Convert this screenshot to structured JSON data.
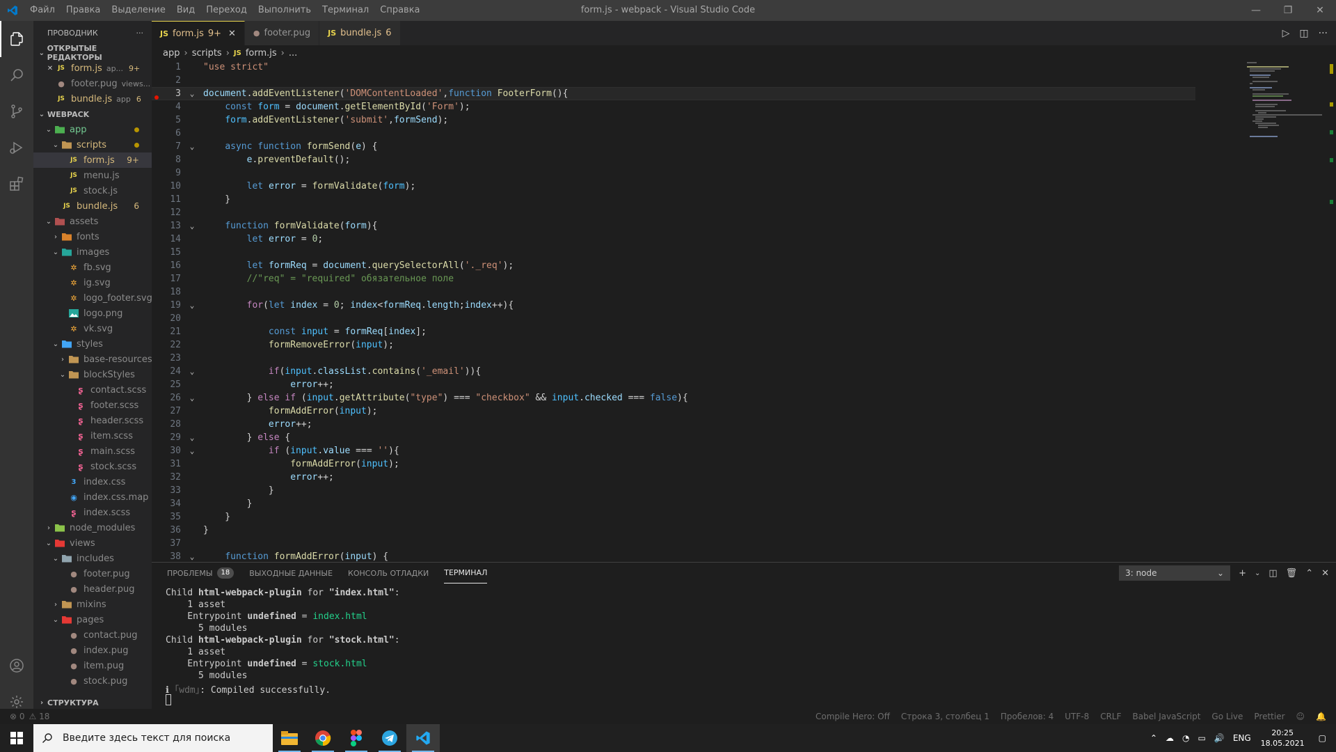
{
  "window": {
    "title": "form.js - webpack - Visual Studio Code",
    "menu": [
      "Файл",
      "Правка",
      "Выделение",
      "Вид",
      "Переход",
      "Выполнить",
      "Терминал",
      "Справка"
    ]
  },
  "sidebar": {
    "title": "ПРОВОДНИК",
    "more": "···",
    "open_editors_label": "ОТКРЫТЫЕ РЕДАКТОРЫ",
    "open_editors": [
      {
        "name": "form.js",
        "desc": "ap...",
        "badge": "9+",
        "icon": "JS",
        "close": "✕"
      },
      {
        "name": "footer.pug",
        "desc": "views...",
        "badge": "",
        "icon": "pug"
      },
      {
        "name": "bundle.js",
        "desc": "app",
        "badge": "6",
        "icon": "JS"
      }
    ],
    "workspace_label": "WEBPACK",
    "outline_label": "СТРУКТУРА",
    "tree": [
      {
        "label": "app",
        "depth": 1,
        "type": "folder-app",
        "open": true,
        "dot": true,
        "color": "green"
      },
      {
        "label": "scripts",
        "depth": 2,
        "type": "folder",
        "open": true,
        "dot": true,
        "color": "yellow"
      },
      {
        "label": "form.js",
        "depth": 3,
        "type": "js",
        "badge": "9+",
        "color": "yellow",
        "selected": true
      },
      {
        "label": "menu.js",
        "depth": 3,
        "type": "js",
        "color": "dim"
      },
      {
        "label": "stock.js",
        "depth": 3,
        "type": "js",
        "color": "dim"
      },
      {
        "label": "bundle.js",
        "depth": 2,
        "type": "js",
        "badge": "6",
        "color": "yellow"
      },
      {
        "label": "assets",
        "depth": 1,
        "type": "folder-assets",
        "open": true,
        "color": "dim"
      },
      {
        "label": "fonts",
        "depth": 2,
        "type": "folder-fonts",
        "open": false,
        "color": "dim"
      },
      {
        "label": "images",
        "depth": 2,
        "type": "folder-images",
        "open": true,
        "color": "dim"
      },
      {
        "label": "fb.svg",
        "depth": 3,
        "type": "svg",
        "color": "dim"
      },
      {
        "label": "ig.svg",
        "depth": 3,
        "type": "svg",
        "color": "dim"
      },
      {
        "label": "logo_footer.svg",
        "depth": 3,
        "type": "svg",
        "color": "dim"
      },
      {
        "label": "logo.png",
        "depth": 3,
        "type": "png",
        "color": "dim"
      },
      {
        "label": "vk.svg",
        "depth": 3,
        "type": "svg",
        "color": "dim"
      },
      {
        "label": "styles",
        "depth": 2,
        "type": "folder-styles",
        "open": true,
        "color": "dim"
      },
      {
        "label": "base-resources",
        "depth": 3,
        "type": "folder",
        "open": false,
        "color": "dim"
      },
      {
        "label": "blockStyles",
        "depth": 3,
        "type": "folder",
        "open": true,
        "color": "dim"
      },
      {
        "label": "contact.scss",
        "depth": 4,
        "type": "scss",
        "color": "dim"
      },
      {
        "label": "footer.scss",
        "depth": 4,
        "type": "scss",
        "color": "dim"
      },
      {
        "label": "header.scss",
        "depth": 4,
        "type": "scss",
        "color": "dim"
      },
      {
        "label": "item.scss",
        "depth": 4,
        "type": "scss",
        "color": "dim"
      },
      {
        "label": "main.scss",
        "depth": 4,
        "type": "scss",
        "color": "dim"
      },
      {
        "label": "stock.scss",
        "depth": 4,
        "type": "scss",
        "color": "dim"
      },
      {
        "label": "index.css",
        "depth": 3,
        "type": "css",
        "color": "dim"
      },
      {
        "label": "index.css.map",
        "depth": 3,
        "type": "map",
        "color": "dim"
      },
      {
        "label": "index.scss",
        "depth": 3,
        "type": "scss",
        "color": "dim"
      },
      {
        "label": "node_modules",
        "depth": 1,
        "type": "folder-node",
        "open": false,
        "color": "dim"
      },
      {
        "label": "views",
        "depth": 1,
        "type": "folder-views",
        "open": true,
        "color": "dim"
      },
      {
        "label": "includes",
        "depth": 2,
        "type": "folder-inc",
        "open": true,
        "color": "dim"
      },
      {
        "label": "footer.pug",
        "depth": 3,
        "type": "pug",
        "color": "dim"
      },
      {
        "label": "header.pug",
        "depth": 3,
        "type": "pug",
        "color": "dim"
      },
      {
        "label": "mixins",
        "depth": 2,
        "type": "folder",
        "open": false,
        "color": "dim"
      },
      {
        "label": "pages",
        "depth": 2,
        "type": "folder-views",
        "open": true,
        "color": "dim"
      },
      {
        "label": "contact.pug",
        "depth": 3,
        "type": "pug",
        "color": "dim"
      },
      {
        "label": "index.pug",
        "depth": 3,
        "type": "pug",
        "color": "dim"
      },
      {
        "label": "item.pug",
        "depth": 3,
        "type": "pug",
        "color": "dim"
      },
      {
        "label": "stock.pug",
        "depth": 3,
        "type": "pug",
        "color": "dim"
      }
    ]
  },
  "tabs": [
    {
      "name": "form.js",
      "badge": "9+",
      "icon": "JS",
      "active": true
    },
    {
      "name": "footer.pug",
      "badge": "",
      "icon": "pug",
      "active": false
    },
    {
      "name": "bundle.js",
      "badge": "6",
      "icon": "JS",
      "active": false
    }
  ],
  "breadcrumb": [
    "app",
    "scripts",
    "form.js",
    "..."
  ],
  "editor": {
    "lines": [
      {
        "n": 1,
        "fold": false,
        "html": "<span style='color:#ce9178'>\"use strict\"</span>"
      },
      {
        "n": 2,
        "fold": false,
        "html": ""
      },
      {
        "n": 3,
        "fold": true,
        "current": true,
        "html": "<span style='color:#9cdcfe'>document</span>.<span style='color:#dcdcaa'>addEventListener</span>(<span style='color:#ce9178'>'DOMContentLoaded'</span>,<span style='color:#569cd6'>function</span> <span style='color:#dcdcaa'>FooterForm</span>(){"
      },
      {
        "n": 4,
        "fold": false,
        "html": "    <span style='color:#569cd6'>const</span> <span style='color:#4fc1ff'>form</span> = <span style='color:#9cdcfe'>document</span>.<span style='color:#dcdcaa'>getElementById</span>(<span style='color:#ce9178'>'Form'</span>);"
      },
      {
        "n": 5,
        "fold": false,
        "html": "    <span style='color:#4fc1ff'>form</span>.<span style='color:#dcdcaa'>addEventListener</span>(<span style='color:#ce9178'>'submit'</span>,<span style='color:#9cdcfe'>formSend</span>);"
      },
      {
        "n": 6,
        "fold": false,
        "html": ""
      },
      {
        "n": 7,
        "fold": true,
        "html": "    <span style='color:#569cd6'>async</span> <span style='color:#569cd6'>function</span> <span style='color:#dcdcaa'>formSend</span>(<span style='color:#9cdcfe'>e</span>) {"
      },
      {
        "n": 8,
        "fold": false,
        "html": "        <span style='color:#9cdcfe'>e</span>.<span style='color:#dcdcaa'>preventDefault</span>();"
      },
      {
        "n": 9,
        "fold": false,
        "html": ""
      },
      {
        "n": 10,
        "fold": false,
        "html": "        <span style='color:#569cd6'>let</span> <span style='color:#9cdcfe'>error</span> = <span style='color:#dcdcaa'>formValidate</span>(<span style='color:#4fc1ff'>form</span>);"
      },
      {
        "n": 11,
        "fold": false,
        "html": "    }"
      },
      {
        "n": 12,
        "fold": false,
        "html": ""
      },
      {
        "n": 13,
        "fold": true,
        "html": "    <span style='color:#569cd6'>function</span> <span style='color:#dcdcaa'>formValidate</span>(<span style='color:#9cdcfe'>form</span>){"
      },
      {
        "n": 14,
        "fold": false,
        "html": "        <span style='color:#569cd6'>let</span> <span style='color:#9cdcfe'>error</span> = <span style='color:#b5cea8'>0</span>;"
      },
      {
        "n": 15,
        "fold": false,
        "html": ""
      },
      {
        "n": 16,
        "fold": false,
        "html": "        <span style='color:#569cd6'>let</span> <span style='color:#9cdcfe'>formReq</span> = <span style='color:#9cdcfe'>document</span>.<span style='color:#dcdcaa'>querySelectorAll</span>(<span style='color:#ce9178'>'._req'</span>);"
      },
      {
        "n": 17,
        "fold": false,
        "html": "        <span style='color:#6a9955'>//\"req\" = \"required\" обязательное поле</span>"
      },
      {
        "n": 18,
        "fold": false,
        "html": ""
      },
      {
        "n": 19,
        "fold": true,
        "html": "        <span style='color:#c586c0'>for</span>(<span style='color:#569cd6'>let</span> <span style='color:#9cdcfe'>index</span> = <span style='color:#b5cea8'>0</span>; <span style='color:#9cdcfe'>index</span>&lt;<span style='color:#9cdcfe'>formReq</span>.<span style='color:#9cdcfe'>length</span>;<span style='color:#9cdcfe'>index</span>++){"
      },
      {
        "n": 20,
        "fold": false,
        "html": ""
      },
      {
        "n": 21,
        "fold": false,
        "html": "            <span style='color:#569cd6'>const</span> <span style='color:#4fc1ff'>input</span> = <span style='color:#9cdcfe'>formReq</span>[<span style='color:#9cdcfe'>index</span>];"
      },
      {
        "n": 22,
        "fold": false,
        "html": "            <span style='color:#dcdcaa'>formRemoveError</span>(<span style='color:#4fc1ff'>input</span>);"
      },
      {
        "n": 23,
        "fold": false,
        "html": ""
      },
      {
        "n": 24,
        "fold": true,
        "html": "            <span style='color:#c586c0'>if</span>(<span style='color:#4fc1ff'>input</span>.<span style='color:#9cdcfe'>classList</span>.<span style='color:#dcdcaa'>contains</span>(<span style='color:#ce9178'>'_email'</span>)){"
      },
      {
        "n": 25,
        "fold": false,
        "html": "                <span style='color:#9cdcfe'>error</span>++;"
      },
      {
        "n": 26,
        "fold": true,
        "html": "        } <span style='color:#c586c0'>else</span> <span style='color:#c586c0'>if</span> (<span style='color:#4fc1ff'>input</span>.<span style='color:#dcdcaa'>getAttribute</span>(<span style='color:#ce9178'>\"type\"</span>) === <span style='color:#ce9178'>\"checkbox\"</span> &amp;&amp; <span style='color:#4fc1ff'>input</span>.<span style='color:#9cdcfe'>checked</span> === <span style='color:#569cd6'>false</span>){"
      },
      {
        "n": 27,
        "fold": false,
        "html": "            <span style='color:#dcdcaa'>formAddError</span>(<span style='color:#4fc1ff'>input</span>);"
      },
      {
        "n": 28,
        "fold": false,
        "html": "            <span style='color:#9cdcfe'>error</span>++;"
      },
      {
        "n": 29,
        "fold": true,
        "html": "        } <span style='color:#c586c0'>else</span> {"
      },
      {
        "n": 30,
        "fold": true,
        "html": "            <span style='color:#c586c0'>if</span> (<span style='color:#4fc1ff'>input</span>.<span style='color:#9cdcfe'>value</span> === <span style='color:#ce9178'>''</span>){"
      },
      {
        "n": 31,
        "fold": false,
        "html": "                <span style='color:#dcdcaa'>formAddError</span>(<span style='color:#4fc1ff'>input</span>);"
      },
      {
        "n": 32,
        "fold": false,
        "html": "                <span style='color:#9cdcfe'>error</span>++;"
      },
      {
        "n": 33,
        "fold": false,
        "html": "            }"
      },
      {
        "n": 34,
        "fold": false,
        "html": "        }"
      },
      {
        "n": 35,
        "fold": false,
        "html": "    }"
      },
      {
        "n": 36,
        "fold": false,
        "html": "}"
      },
      {
        "n": 37,
        "fold": false,
        "html": ""
      },
      {
        "n": 38,
        "fold": true,
        "html": "    <span style='color:#569cd6'>function</span> <span style='color:#dcdcaa'>formAddError</span>(<span style='color:#9cdcfe'>input</span>) {"
      }
    ]
  },
  "panel": {
    "tabs": [
      {
        "label": "ПРОБЛЕМЫ",
        "badge": "18",
        "active": false
      },
      {
        "label": "ВЫХОДНЫЕ ДАННЫЕ",
        "badge": "",
        "active": false
      },
      {
        "label": "КОНСОЛЬ ОТЛАДКИ",
        "badge": "",
        "active": false
      },
      {
        "label": "ТЕРМИНАЛ",
        "badge": "",
        "active": true
      }
    ],
    "terminal_select": "3: node",
    "terminal_lines": [
      "Child <b>html-webpack-plugin</b> for <b>\"index.html\"</b>:",
      "    1 asset",
      "    Entrypoint <b>undefined</b> = <span class='t-green'>index.html</span>",
      "      5 modules",
      "Child <b>html-webpack-plugin</b> for <b>\"stock.html\"</b>:",
      "    1 asset",
      "    Entrypoint <b>undefined</b> = <span class='t-green'>stock.html</span>",
      "      5 modules",
      "ℹ <span class='t-dim'>｢wdm｣</span>: Compiled successfully."
    ]
  },
  "status": {
    "errors": "⊗ 0",
    "warnings": "⚠ 18",
    "right": [
      "Compile Hero: Off",
      "Строка 3, столбец 1",
      "Пробелов: 4",
      "UTF-8",
      "CRLF",
      "Babel JavaScript",
      "Go Live",
      "Prettier"
    ]
  },
  "taskbar": {
    "search_placeholder": "Введите здесь текст для поиска",
    "lang": "ENG",
    "time": "20:25",
    "date": "18.05.2021"
  }
}
